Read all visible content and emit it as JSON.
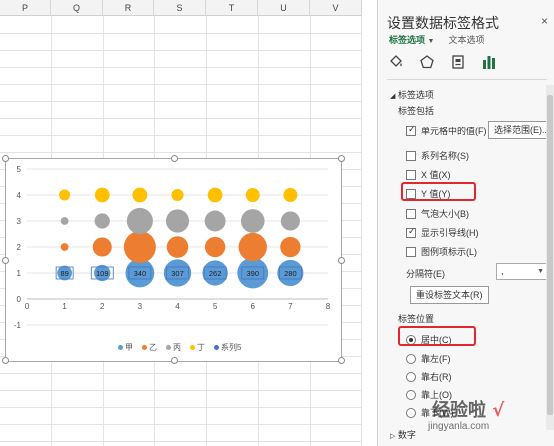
{
  "sheet": {
    "columns": [
      "P",
      "Q",
      "R",
      "S",
      "T",
      "U",
      "V"
    ]
  },
  "chart": {
    "legend": [
      {
        "label": "甲",
        "color": "#5b9bd5"
      },
      {
        "label": "乙",
        "color": "#ed7d31"
      },
      {
        "label": "丙",
        "color": "#a5a5a5"
      },
      {
        "label": "丁",
        "color": "#ffc000"
      },
      {
        "label": "系列5",
        "color": "#4472c4"
      }
    ]
  },
  "chart_data": {
    "type": "scatter",
    "subtype": "bubble",
    "xlim": [
      0,
      8
    ],
    "ylim": [
      -1,
      5
    ],
    "x_ticks": [
      "0",
      "1",
      "2",
      "3",
      "4",
      "5",
      "6",
      "7",
      "8"
    ],
    "y_ticks": [
      "-1",
      "0",
      "1",
      "2",
      "3",
      "4",
      "5"
    ],
    "grid": true,
    "legend_position": "bottom",
    "series": [
      {
        "name": "甲",
        "color": "#5b9bd5",
        "y": 1,
        "x": [
          1,
          2,
          3,
          4,
          5,
          6,
          7
        ],
        "labels": [
          "89",
          "109",
          "340",
          "307",
          "262",
          "390",
          "280"
        ],
        "sizes": [
          89,
          109,
          340,
          307,
          262,
          390,
          280
        ]
      },
      {
        "name": "乙",
        "color": "#ed7d31",
        "y": 2,
        "x": [
          1,
          2,
          3,
          4,
          5,
          6,
          7
        ],
        "sizes": [
          25,
          150,
          420,
          190,
          170,
          330,
          170
        ]
      },
      {
        "name": "丙",
        "color": "#a5a5a5",
        "y": 3,
        "x": [
          1,
          2,
          3,
          4,
          5,
          6,
          7
        ],
        "sizes": [
          25,
          95,
          280,
          220,
          180,
          230,
          150
        ]
      },
      {
        "name": "丁",
        "color": "#ffc000",
        "y": 4,
        "x": [
          1,
          2,
          3,
          4,
          5,
          6,
          7
        ],
        "sizes": [
          50,
          90,
          90,
          60,
          90,
          80,
          80
        ]
      }
    ]
  },
  "pane": {
    "title": "设置数据标签格式",
    "close": "×",
    "tab_label_options": "标签选项",
    "tab_label_dropdown": "▼",
    "tab_text_options": "文本选项",
    "icons": [
      "fill-icon",
      "pentagon-icon",
      "size-properties-icon",
      "bar-chart-icon"
    ],
    "section_label_options": "标签选项",
    "label_contains": "标签包括",
    "options": {
      "cell_value": "单元格中的值(F)",
      "series_name": "系列名称(S)",
      "x_value": "X 值(X)",
      "y_value": "Y 值(Y)",
      "bubble_size": "气泡大小(B)",
      "leader_lines": "显示引导线(H)",
      "legend_key": "图例项标示(L)"
    },
    "select_range_button": "选择范围(E)...",
    "separator_label": "分隔符(E)",
    "separator_value": ",",
    "reset_button": "重设标签文本(R)",
    "label_position": "标签位置",
    "positions": {
      "center": "居中(C)",
      "left": "靠左(F)",
      "right": "靠右(R)",
      "above": "靠上(O)",
      "below": "靠下(W)"
    },
    "number_section": "数字"
  },
  "watermark": {
    "text": "经验啦",
    "sub": "jingyanla.com"
  }
}
